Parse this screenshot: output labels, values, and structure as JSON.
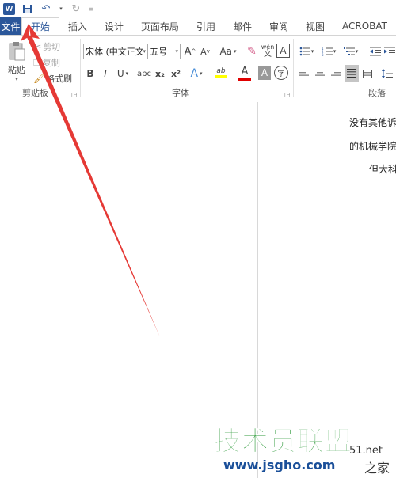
{
  "quick_access": {
    "logo": "W",
    "icons": [
      "word-logo",
      "save-icon",
      "undo-icon",
      "redo-icon",
      "customize-icon"
    ]
  },
  "tabs": {
    "file": "文件",
    "items": [
      "开始",
      "插入",
      "设计",
      "页面布局",
      "引用",
      "邮件",
      "审阅",
      "视图",
      "ACROBAT"
    ]
  },
  "clipboard": {
    "paste": "粘贴",
    "cut": "剪切",
    "copy": "复制",
    "format_painter": "格式刷",
    "group_label": "剪贴板"
  },
  "font": {
    "font_name": "宋体 (中文正文",
    "font_size": "五号",
    "grow": "A",
    "shrink": "A",
    "change_case": "Aa",
    "phonetic": "wén",
    "char_border": "A",
    "bold": "B",
    "italic": "I",
    "underline": "U",
    "strikethrough": "abc",
    "subscript": "x₂",
    "superscript": "x²",
    "text_effects": "A",
    "highlight": "ab",
    "font_color": "A",
    "char_shading": "A",
    "enclose": "字",
    "group_label": "字体"
  },
  "paragraph": {
    "group_label": "段落"
  },
  "document": {
    "lines": [
      "没有其他诉",
      "的机械学院",
      "但大科"
    ]
  },
  "watermark": {
    "main": "技术员联盟",
    "sub": "www.jsgho.com",
    "domain": "51.net",
    "suffix": "之家"
  },
  "colors": {
    "accent": "#2b579a",
    "arrow": "#e53935",
    "watermark_green": "#2e9a3a",
    "watermark_blue": "#1a4f99"
  }
}
